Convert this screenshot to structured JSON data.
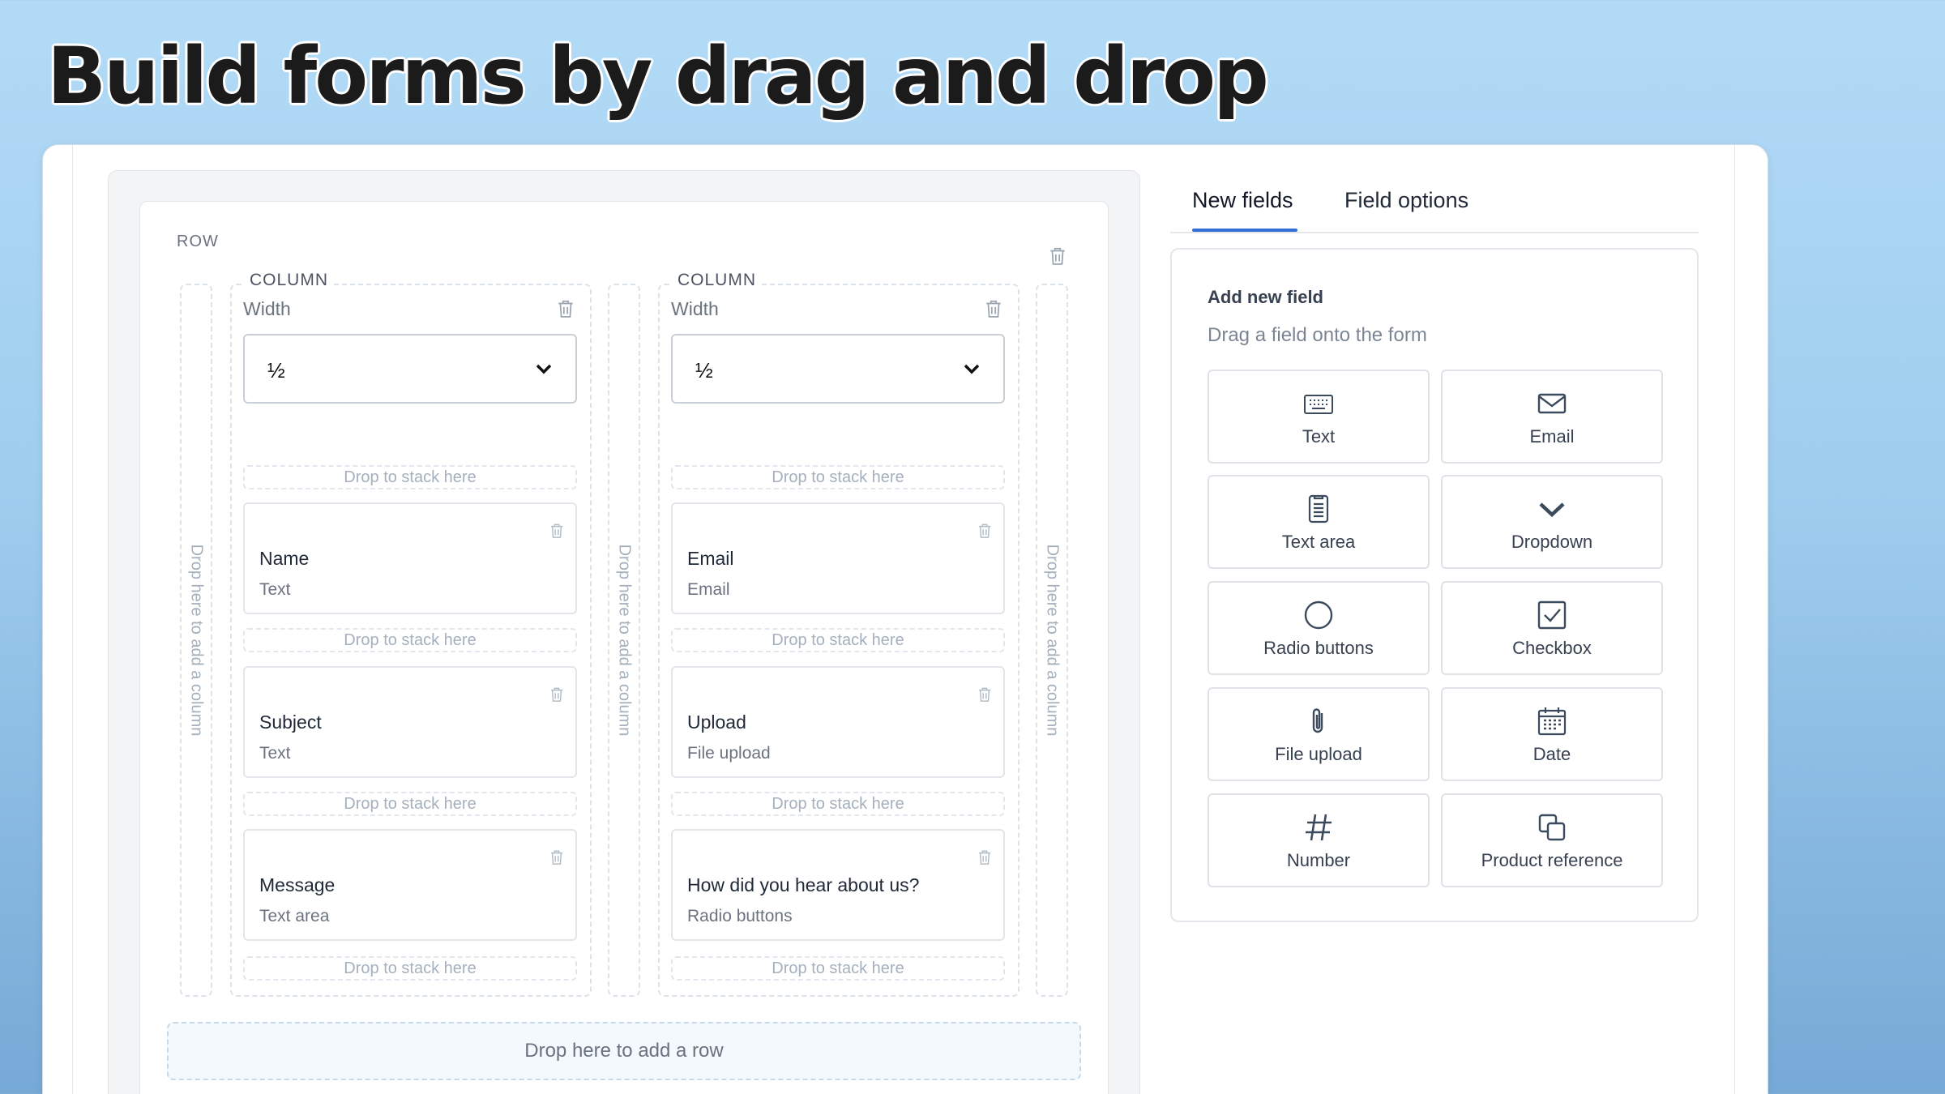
{
  "headline": "Build forms by drag and drop",
  "builder": {
    "row_label": "ROW",
    "add_column_text": "Drop here to add a column",
    "add_row_text": "Drop here to add a row",
    "stack_drop_text": "Drop to stack here",
    "columns": [
      {
        "title": "COLUMN",
        "width_label": "Width",
        "width_value": "½",
        "fields": [
          {
            "name": "Name",
            "type": "Text"
          },
          {
            "name": "Subject",
            "type": "Text"
          },
          {
            "name": "Message",
            "type": "Text area"
          }
        ]
      },
      {
        "title": "COLUMN",
        "width_label": "Width",
        "width_value": "½",
        "fields": [
          {
            "name": "Email",
            "type": "Email"
          },
          {
            "name": "Upload",
            "type": "File upload"
          },
          {
            "name": "How did you hear about us?",
            "type": "Radio buttons"
          }
        ]
      }
    ]
  },
  "panel": {
    "tabs": [
      {
        "label": "New fields",
        "active": true
      },
      {
        "label": "Field options",
        "active": false
      }
    ],
    "title": "Add new field",
    "subtitle": "Drag a field onto the form",
    "field_types": [
      {
        "label": "Text",
        "icon": "keyboard-icon"
      },
      {
        "label": "Email",
        "icon": "envelope-icon"
      },
      {
        "label": "Text area",
        "icon": "document-icon"
      },
      {
        "label": "Dropdown",
        "icon": "chevron-down-icon"
      },
      {
        "label": "Radio buttons",
        "icon": "radio-circle-icon"
      },
      {
        "label": "Checkbox",
        "icon": "checkbox-icon"
      },
      {
        "label": "File upload",
        "icon": "paperclip-icon"
      },
      {
        "label": "Date",
        "icon": "calendar-icon"
      },
      {
        "label": "Number",
        "icon": "hash-icon"
      },
      {
        "label": "Product reference",
        "icon": "copy-icon"
      }
    ]
  },
  "colors": {
    "accent": "#2f6fd6",
    "icon": "#3b4a5c",
    "muted_trash": "#9aa5b1"
  }
}
